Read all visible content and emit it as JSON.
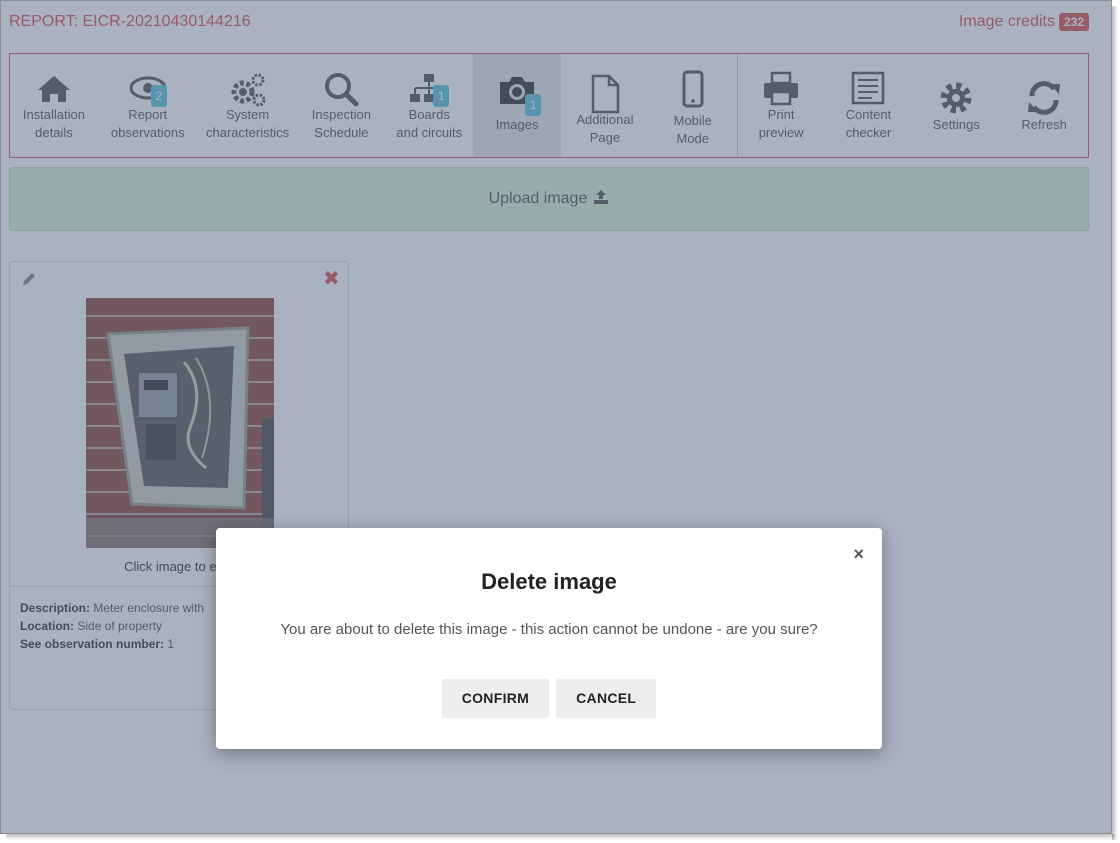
{
  "header": {
    "report_title": "REPORT: EICR-20210430144216",
    "image_credits_label": "Image credits",
    "image_credits_count": "232"
  },
  "toolbar": {
    "items": [
      {
        "label_line1": "Installation",
        "label_line2": "details",
        "icon": "home-icon"
      },
      {
        "label_line1": "Report",
        "label_line2": "observations",
        "icon": "eye-icon",
        "count": "2"
      },
      {
        "label_line1": "System",
        "label_line2": "characteristics",
        "icon": "cogs-icon"
      },
      {
        "label_line1": "Inspection",
        "label_line2": "Schedule",
        "icon": "search-icon"
      },
      {
        "label_line1": "Boards",
        "label_line2": "and circuits",
        "icon": "sitemap-icon",
        "count": "1"
      },
      {
        "label_line1": "Images",
        "icon": "camera-icon",
        "count": "1",
        "active": true
      },
      {
        "label_line1": "Additional",
        "label_line2": "Page",
        "icon": "file-icon"
      },
      {
        "label_line1": "Mobile",
        "label_line2": "Mode",
        "icon": "mobile-icon"
      },
      {
        "label_line1": "Print",
        "label_line2": "preview",
        "icon": "print-icon"
      },
      {
        "label_line1": "Content",
        "label_line2": "checker",
        "icon": "checklist-icon"
      },
      {
        "label_line1": "Settings",
        "icon": "gear-icon"
      },
      {
        "label_line1": "Refresh",
        "icon": "refresh-icon"
      }
    ]
  },
  "upload": {
    "label": "Upload image"
  },
  "image_card": {
    "caption": "Click image to enla",
    "description_label": "Description:",
    "description_value": "Meter enclosure with",
    "location_label": "Location:",
    "location_value": "Side of property",
    "observation_label": "See observation number:",
    "observation_value": "1"
  },
  "modal": {
    "title": "Delete image",
    "message": "You are about to delete this image - this action cannot be undone - are you sure?",
    "confirm_label": "CONFIRM",
    "cancel_label": "CANCEL",
    "close_glyph": "×"
  },
  "colors": {
    "accent_red": "#d9534f",
    "badge_blue": "#5bc0de",
    "upload_green": "#dff0d8",
    "overlay": "#556680"
  }
}
